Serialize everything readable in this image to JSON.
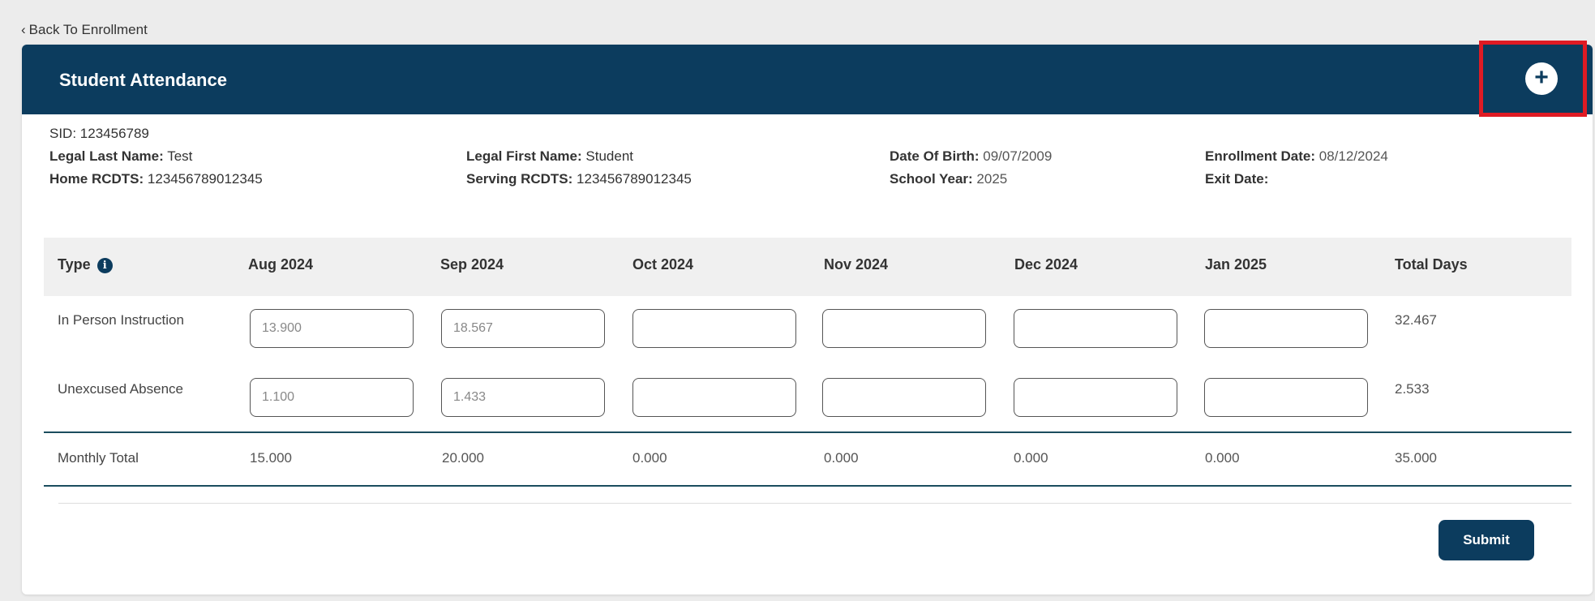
{
  "nav": {
    "back_label": "Back To Enrollment"
  },
  "header": {
    "title": "Student Attendance",
    "add_symbol": "+"
  },
  "student": {
    "sid_label": "SID:",
    "sid": "123456789",
    "last_name_label": "Legal Last Name:",
    "last_name": "Test",
    "home_rcdts_label": "Home RCDTS:",
    "home_rcdts": "123456789012345",
    "first_name_label": "Legal First Name:",
    "first_name": "Student",
    "serving_rcdts_label": "Serving RCDTS:",
    "serving_rcdts": "123456789012345",
    "dob_label": "Date Of Birth:",
    "dob": "09/07/2009",
    "school_year_label": "School Year:",
    "school_year": "2025",
    "enrollment_date_label": "Enrollment Date:",
    "enrollment_date": "08/12/2024",
    "exit_date_label": "Exit Date:",
    "exit_date": ""
  },
  "table": {
    "columns": [
      "Type",
      "Aug 2024",
      "Sep 2024",
      "Oct 2024",
      "Nov 2024",
      "Dec 2024",
      "Jan 2025",
      "Total Days"
    ],
    "info_icon": "i",
    "rows": [
      {
        "label": "In Person Instruction",
        "values": [
          "13.900",
          "18.567",
          "",
          "",
          "",
          ""
        ],
        "total": "32.467"
      },
      {
        "label": "Unexcused Absence",
        "values": [
          "1.100",
          "1.433",
          "",
          "",
          "",
          ""
        ],
        "total": "2.533"
      }
    ],
    "monthly_total": {
      "label": "Monthly Total",
      "values": [
        "15.000",
        "20.000",
        "0.000",
        "0.000",
        "0.000",
        "0.000"
      ],
      "total": "35.000"
    }
  },
  "footer": {
    "submit_label": "Submit"
  },
  "colors": {
    "brand": "#0c3c5e",
    "highlight": "#e01b24"
  }
}
